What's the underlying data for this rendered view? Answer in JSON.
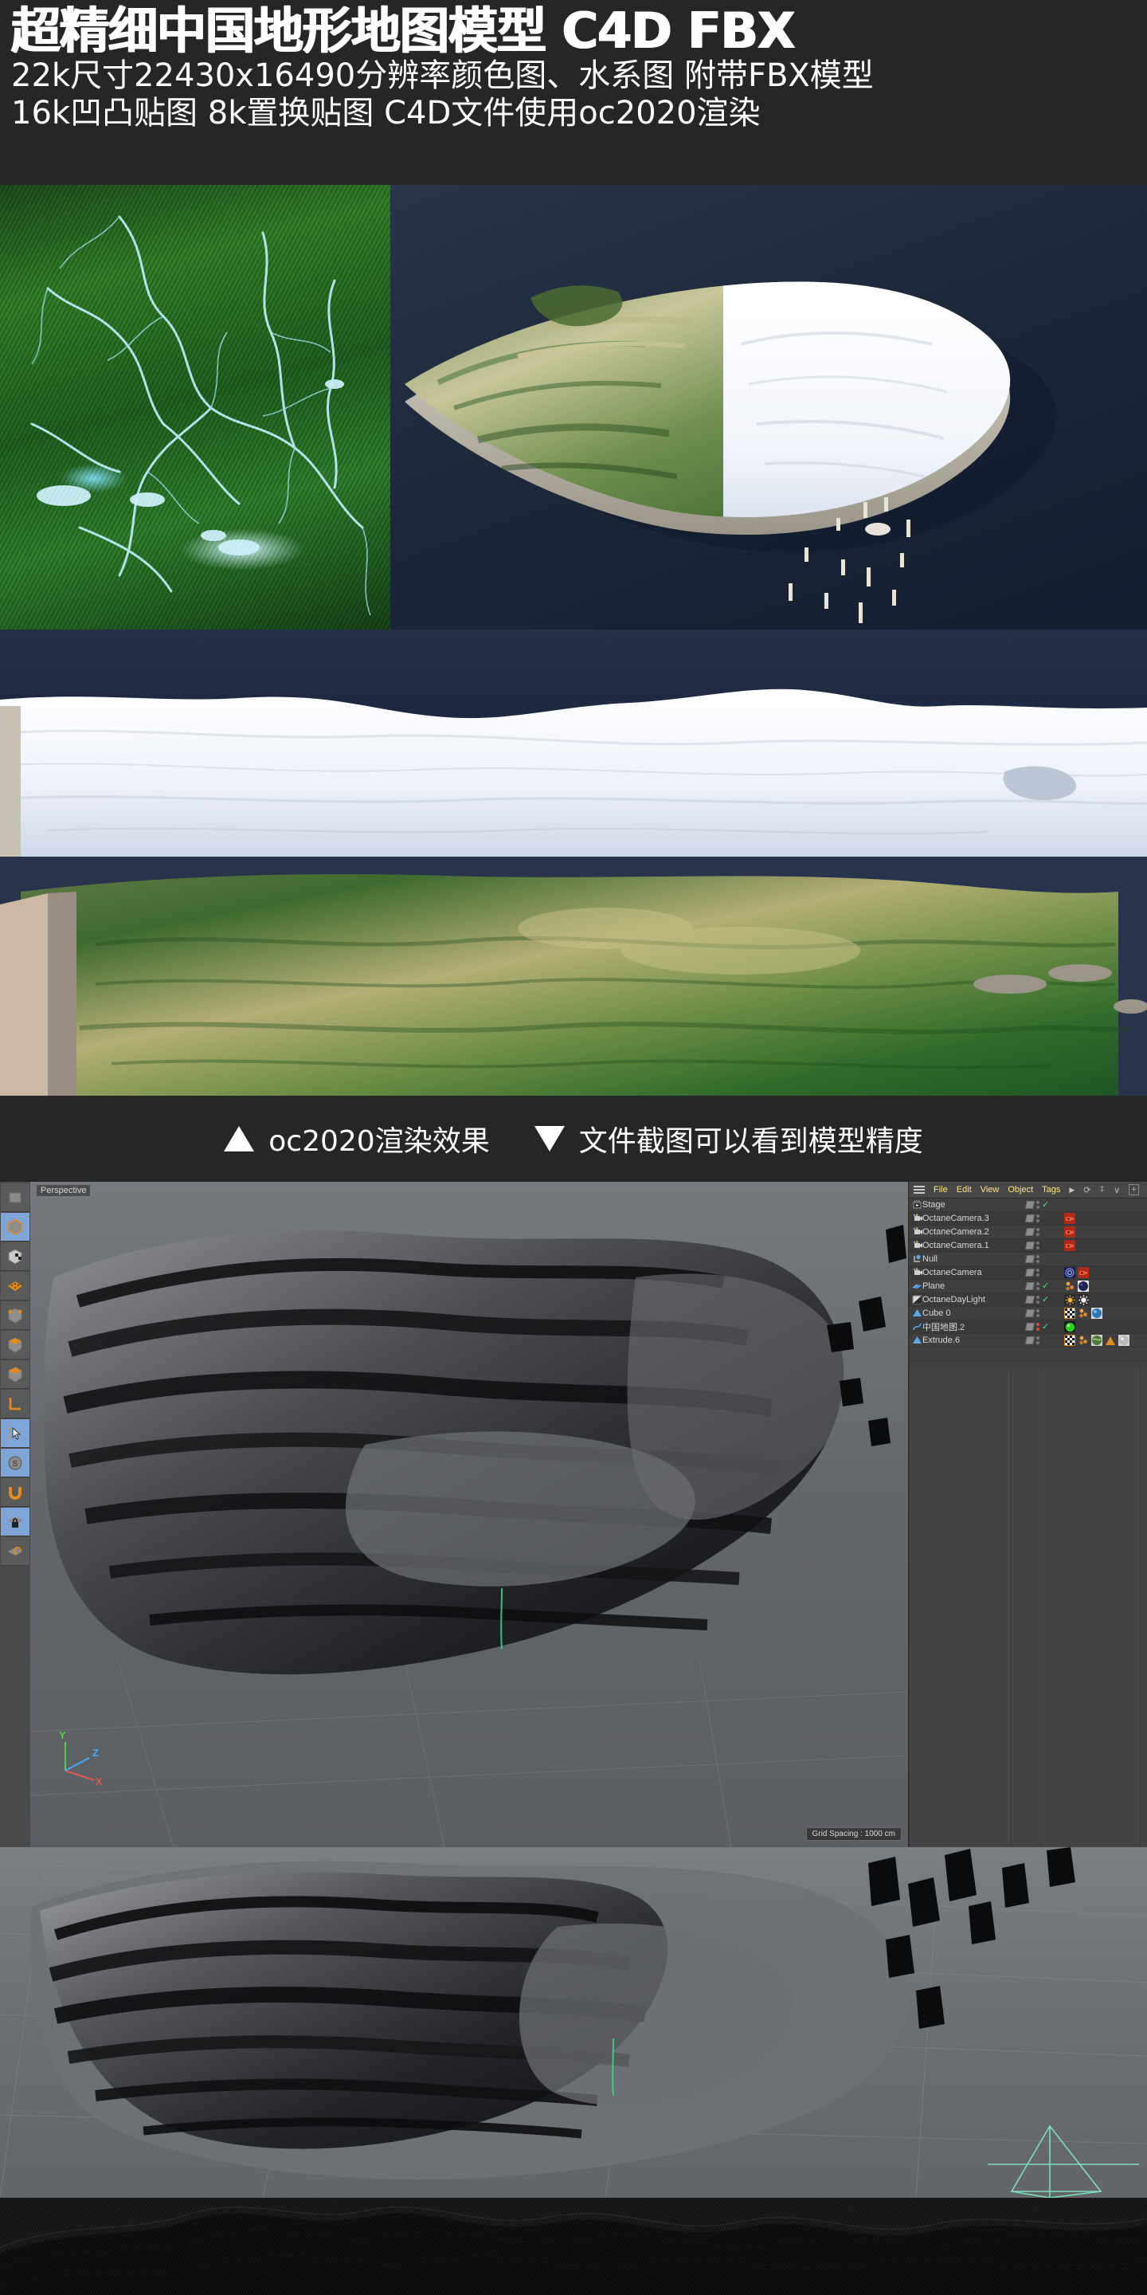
{
  "header": {
    "title": "超精细中国地形地图模型 C4D FBX",
    "line2": "22k尺寸22430x16490分辨率颜色图、水系图 附带FBX模型",
    "line3": "16k凹凸贴图 8k置换贴图 C4D文件使用oc2020渲染"
  },
  "caption": {
    "left_marker": "▲",
    "left_text": "oc2020渲染效果",
    "right_marker": "▼",
    "right_text": "文件截图可以看到模型精度"
  },
  "c4d": {
    "viewport_label": "Perspective",
    "grid_spacing": "Grid Spacing : 1000 cm",
    "axis": {
      "x": "X",
      "y": "Y",
      "z": "Z"
    },
    "menu": [
      "File",
      "Edit",
      "View",
      "Object",
      "Tags"
    ],
    "objects": [
      {
        "name": "Stage",
        "icon": "stage-icon",
        "tick": true,
        "dot_red": false,
        "tags": []
      },
      {
        "name": "OctaneCamera.3",
        "icon": "camera-icon",
        "tick": false,
        "dot_red": false,
        "tags": [
          "camera-tag"
        ]
      },
      {
        "name": "OctaneCamera.2",
        "icon": "camera-icon",
        "tick": false,
        "dot_red": false,
        "tags": [
          "camera-tag"
        ]
      },
      {
        "name": "OctaneCamera.1",
        "icon": "camera-icon",
        "tick": false,
        "dot_red": false,
        "tags": [
          "camera-tag"
        ]
      },
      {
        "name": "Null",
        "icon": "null-icon",
        "tick": false,
        "dot_red": false,
        "tags": []
      },
      {
        "name": "OctaneCamera",
        "icon": "camera-icon",
        "tick": false,
        "dot_red": false,
        "tags": [
          "target-tag",
          "camera-tag"
        ]
      },
      {
        "name": "Plane",
        "icon": "plane-icon",
        "tick": true,
        "dot_red": false,
        "tags": [
          "material-dots",
          "material-dark"
        ]
      },
      {
        "name": "OctaneDayLight",
        "icon": "daylight-icon",
        "tick": true,
        "dot_red": false,
        "tags": [
          "sun-tag",
          "light-tag"
        ]
      },
      {
        "name": "Cube 0",
        "icon": "cube-icon",
        "tick": false,
        "dot_red": false,
        "tags": [
          "checker-tag",
          "material-dots",
          "material-blue"
        ]
      },
      {
        "name": "中国地图.2",
        "icon": "spline-icon",
        "tick": true,
        "dot_red": true,
        "tags": [
          "material-green"
        ]
      },
      {
        "name": "Extrude.6",
        "icon": "cube-icon",
        "tick": false,
        "dot_red": false,
        "tags": [
          "checker-tag",
          "material-dots",
          "material-earth",
          "displacer-tag",
          "material-grey"
        ]
      }
    ],
    "toolbar": [
      "model-mode-icon",
      "texture-mode-icon",
      "points-mode-icon",
      "edges-mode-icon",
      "polygons-mode-icon",
      "object-axis-icon",
      "workplane-icon",
      "select-icon",
      "snap-icon",
      "magnet-icon",
      "lock-grid-icon",
      "grid-snap-icon"
    ]
  }
}
